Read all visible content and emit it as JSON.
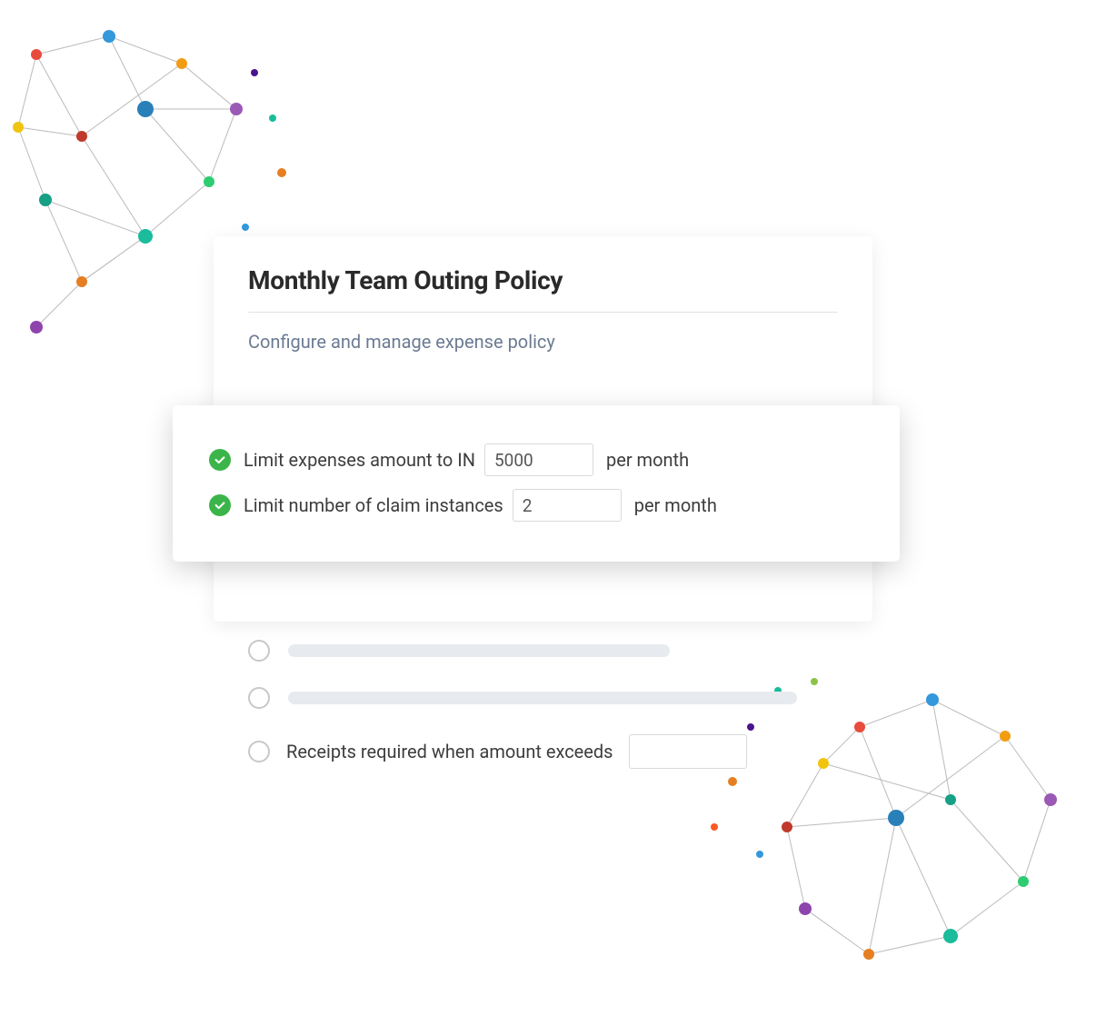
{
  "card": {
    "title": "Monthly Team Outing Policy",
    "subtitle": "Configure and manage expense policy"
  },
  "rules": {
    "expense_limit": {
      "lead": "Limit expenses amount to IN",
      "value": "5000",
      "tail": "per month"
    },
    "claim_limit": {
      "lead": "Limit number of claim instances",
      "value": "2",
      "tail": "per month"
    },
    "receipts": {
      "label": "Receipts required when amount exceeds",
      "value": ""
    }
  },
  "colors": {
    "check_green": "#3bb54a",
    "subtitle": "#6b7b93"
  }
}
